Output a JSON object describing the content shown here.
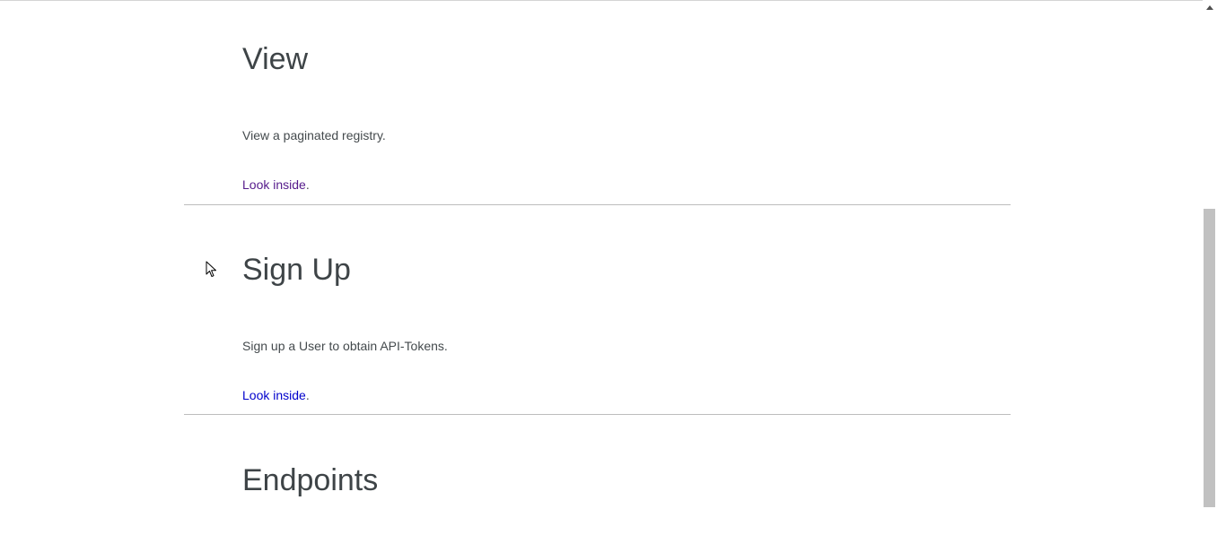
{
  "sections": [
    {
      "title": "View",
      "description": "View a paginated registry.",
      "link_label": "Look inside",
      "link_suffix": ".",
      "link_visited": true
    },
    {
      "title": "Sign Up",
      "description": "Sign up a User to obtain API-Tokens.",
      "link_label": "Look inside",
      "link_suffix": ".",
      "link_visited": false
    },
    {
      "title": "Endpoints"
    }
  ],
  "colors": {
    "heading": "#3e4447",
    "body_text": "#444a4d",
    "link_visited": "#551a8b",
    "link_unvisited": "#0000cc",
    "divider": "#bdbdbd",
    "scroll_thumb": "#c1c1c1"
  },
  "icons": {
    "cursor": "mouse-pointer-icon",
    "scroll_up": "scroll-up-arrow-icon"
  }
}
